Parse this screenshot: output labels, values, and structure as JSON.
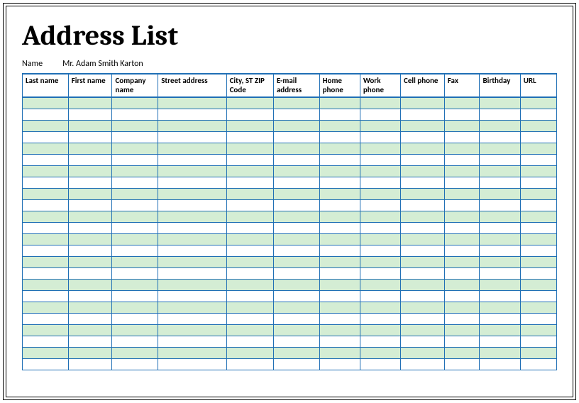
{
  "title": "Address List",
  "name_field": {
    "label": "Name",
    "value": "Mr. Adam Smith Karton"
  },
  "columns": [
    {
      "id": "last_name",
      "label": "Last name",
      "width": "8.6%"
    },
    {
      "id": "first_name",
      "label": "First name",
      "width": "8.2%"
    },
    {
      "id": "company_name",
      "label": "Company name",
      "width": "8.6%"
    },
    {
      "id": "street_address",
      "label": "Street address",
      "width": "12.8%"
    },
    {
      "id": "city_st_zip",
      "label": "City, ST  ZIP Code",
      "width": "8.8%"
    },
    {
      "id": "email_address",
      "label": "E-mail address",
      "width": "8.6%"
    },
    {
      "id": "home_phone",
      "label": "Home phone",
      "width": "7.6%"
    },
    {
      "id": "work_phone",
      "label": "Work phone",
      "width": "7.6%"
    },
    {
      "id": "cell_phone",
      "label": "Cell phone",
      "width": "8.2%"
    },
    {
      "id": "fax",
      "label": "Fax",
      "width": "6.6%"
    },
    {
      "id": "birthday",
      "label": "Birthday",
      "width": "7.6%"
    },
    {
      "id": "url",
      "label": "URL",
      "width": "6.8%"
    }
  ],
  "row_count": 24,
  "colors": {
    "grid_line": "#1f6fb5",
    "band_even": "#d4edd4",
    "band_odd": "#ffffff"
  }
}
